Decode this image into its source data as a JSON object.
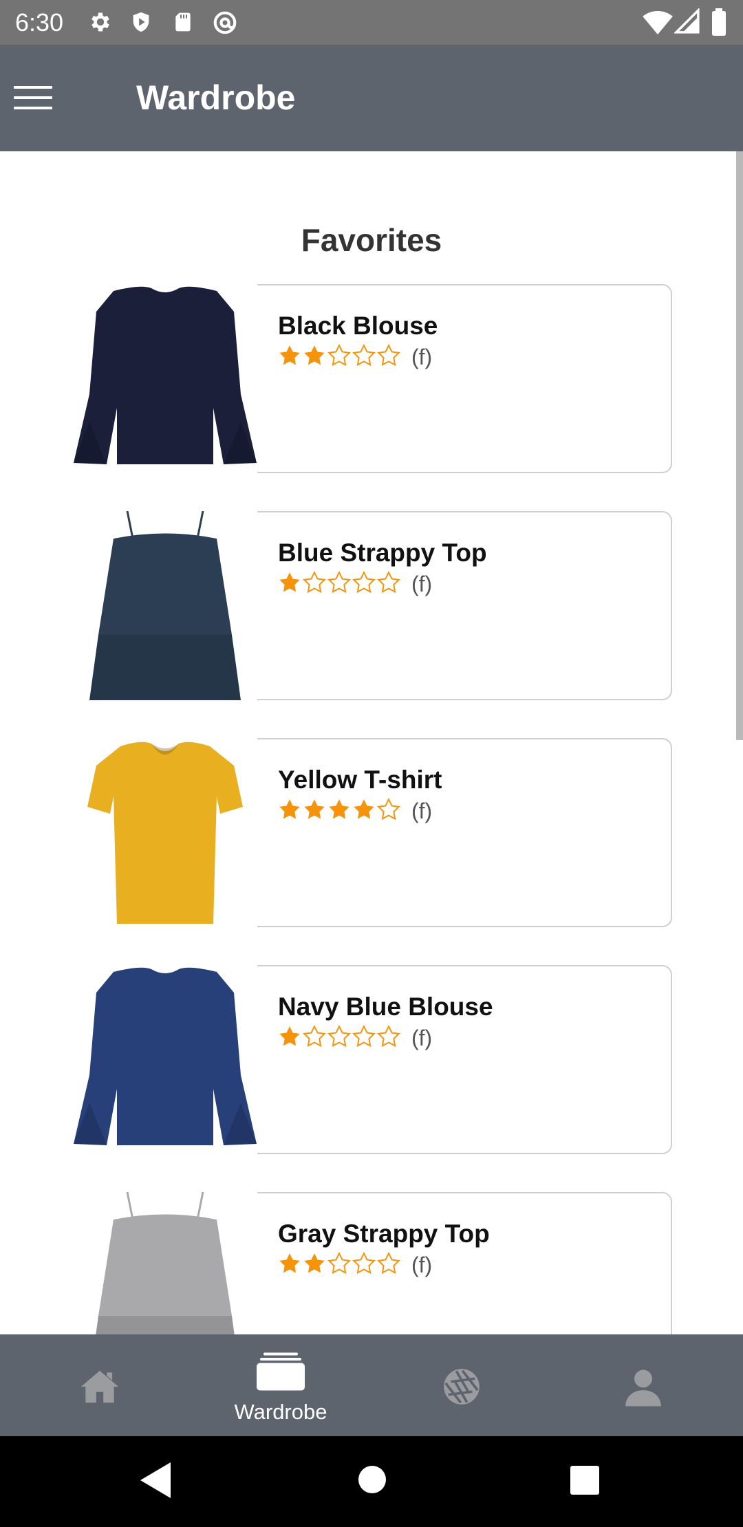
{
  "status_bar": {
    "time": "6:30",
    "left_icons": [
      "settings-icon",
      "shield-play-icon",
      "sd-card-icon",
      "at-sign-icon"
    ],
    "right_icons": [
      "wifi-icon",
      "signal-icon",
      "battery-icon"
    ]
  },
  "app_bar": {
    "title": "Wardrobe",
    "menu_icon": "hamburger-menu-icon"
  },
  "main": {
    "section_title": "Favorites",
    "rating_max": 5,
    "items": [
      {
        "name": "Black Blouse",
        "rating": 2,
        "label": "(f)",
        "color": "#1b1f3a",
        "style": "blouse"
      },
      {
        "name": "Blue Strappy Top",
        "rating": 1,
        "label": "(f)",
        "color": "#2c3e54",
        "style": "strappy"
      },
      {
        "name": "Yellow T-shirt",
        "rating": 4,
        "label": "(f)",
        "color": "#e8b021",
        "style": "tshirt"
      },
      {
        "name": "Navy Blue Blouse",
        "rating": 1,
        "label": "(f)",
        "color": "#27407a",
        "style": "blouse"
      },
      {
        "name": "Gray Strappy Top",
        "rating": 2,
        "label": "(f)",
        "color": "#a9a9ab",
        "style": "strappy"
      }
    ]
  },
  "bottom_nav": {
    "items": [
      {
        "icon": "home-icon",
        "label": ""
      },
      {
        "icon": "wardrobe-icon",
        "label": "Wardrobe"
      },
      {
        "icon": "aperture-icon",
        "label": ""
      },
      {
        "icon": "profile-icon",
        "label": ""
      }
    ],
    "active": "Wardrobe"
  },
  "system_nav": {
    "icons": [
      "back-icon",
      "home-circle-icon",
      "recents-icon"
    ]
  },
  "colors": {
    "app_bar": "#5e646e",
    "status_bar": "#747474",
    "star": "#f5930b",
    "card_border": "#cfcfcf"
  }
}
